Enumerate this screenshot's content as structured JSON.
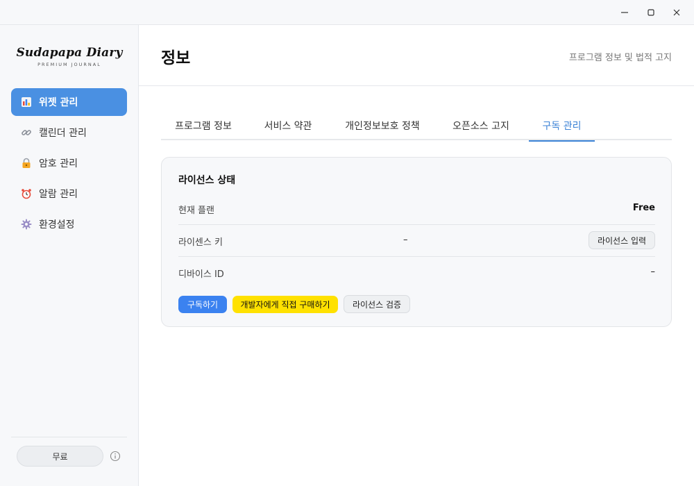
{
  "window": {
    "controls": {
      "minimize": "minimize-icon",
      "maximize": "maximize-icon",
      "close": "close-icon"
    }
  },
  "sidebar": {
    "logo_title": "Sudapapa Diary",
    "logo_subtitle": "PREMIUM JOURNAL",
    "items": [
      {
        "label": "위젯 관리",
        "icon": "chart-icon",
        "active": true
      },
      {
        "label": "캘린더 관리",
        "icon": "link-icon",
        "active": false
      },
      {
        "label": "암호 관리",
        "icon": "lock-icon",
        "active": false
      },
      {
        "label": "알람 관리",
        "icon": "alarm-clock-icon",
        "active": false
      },
      {
        "label": "환경설정",
        "icon": "gear-icon",
        "active": false
      }
    ],
    "plan_label": "무료",
    "info_icon": "info-icon"
  },
  "header": {
    "title": "정보",
    "subtitle": "프로그램 정보 및 법적 고지"
  },
  "tabs": [
    {
      "label": "프로그램 정보",
      "active": false
    },
    {
      "label": "서비스 약관",
      "active": false
    },
    {
      "label": "개인정보보호 정책",
      "active": false
    },
    {
      "label": "오픈소스 고지",
      "active": false
    },
    {
      "label": "구독 관리",
      "active": true
    }
  ],
  "license": {
    "title": "라이선스 상태",
    "rows": {
      "plan": {
        "label": "현재 플랜",
        "value": "Free"
      },
      "key": {
        "label": "라이센스 키",
        "value": "–",
        "button": "라이선스 입력"
      },
      "device": {
        "label": "디바이스 ID",
        "value": "–"
      }
    },
    "actions": {
      "subscribe": "구독하기",
      "buy_direct": "개발자에게 직접 구매하기",
      "verify": "라이선스 검증"
    }
  },
  "colors": {
    "accent": "#4a90e2",
    "primary_button": "#3b82f0",
    "highlight_button": "#ffe100",
    "active_tab": "#3b82d6"
  }
}
